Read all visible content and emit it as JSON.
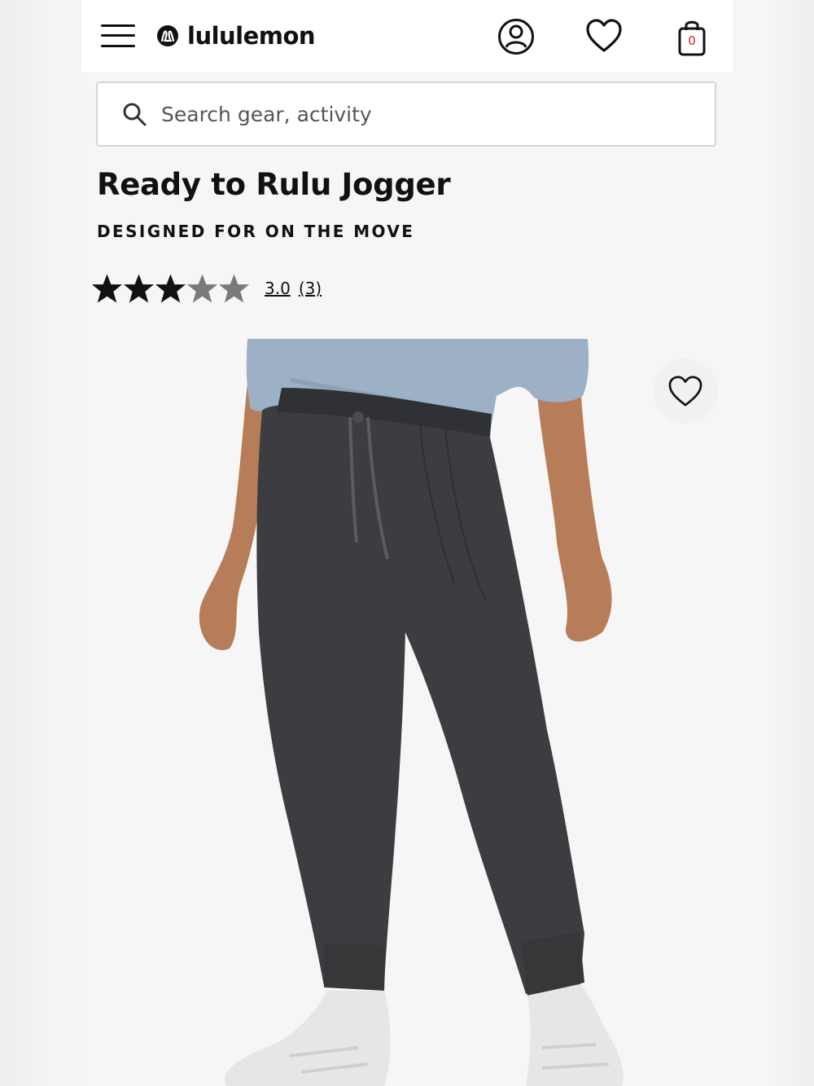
{
  "brand": {
    "name": "lululemon"
  },
  "header": {
    "menu_icon": "hamburger-menu-icon",
    "account_icon": "account-icon",
    "wishlist_icon": "heart-icon",
    "bag_icon": "shopping-bag-icon",
    "bag_count": "0",
    "bag_count_color": "#d22030"
  },
  "search": {
    "placeholder": "Search gear, activity",
    "value": ""
  },
  "product": {
    "title": "Ready to Rulu Jogger",
    "subtitle": "DESIGNED FOR ON THE MOVE",
    "rating": {
      "value": "3.0",
      "count": "(3)",
      "stars_filled": 3,
      "stars_total": 5
    },
    "image": {
      "description_icon": "product-photo",
      "wishlist_button_icon": "heart-icon"
    }
  },
  "colors": {
    "background": "#f6f6f6",
    "header_bg": "#ffffff",
    "text": "#111111",
    "star_filled": "#111111",
    "star_empty": "#7a7a7a",
    "jogger": "#3b3d40",
    "sweater": "#9cb0c6",
    "skin": "#b77d58"
  }
}
